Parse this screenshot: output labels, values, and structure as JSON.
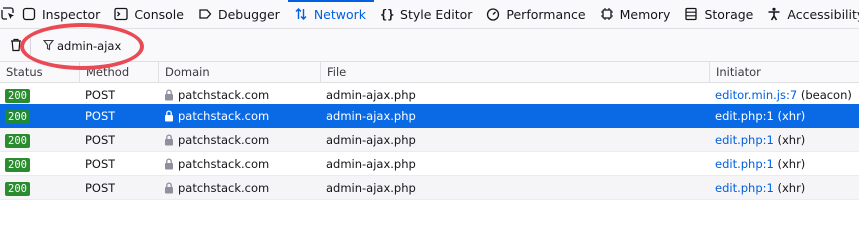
{
  "toolbar": {
    "tabs": [
      {
        "label": "Inspector",
        "icon": "inspector-icon"
      },
      {
        "label": "Console",
        "icon": "console-icon"
      },
      {
        "label": "Debugger",
        "icon": "debugger-icon"
      },
      {
        "label": "Network",
        "icon": "network-icon",
        "active": true
      },
      {
        "label": "Style Editor",
        "icon": "style-editor-icon"
      },
      {
        "label": "Performance",
        "icon": "performance-icon"
      },
      {
        "label": "Memory",
        "icon": "memory-icon"
      },
      {
        "label": "Storage",
        "icon": "storage-icon"
      },
      {
        "label": "Accessibility",
        "icon": "accessibility-icon"
      }
    ],
    "accent_color": "#0061e0"
  },
  "filter": {
    "value": "admin-ajax"
  },
  "table": {
    "columns": [
      "Status",
      "Method",
      "Domain",
      "File",
      "Initiator"
    ],
    "rows": [
      {
        "status": "200",
        "method": "POST",
        "domain": "patchstack.com",
        "file": "admin-ajax.php",
        "initiator_link": "editor.min.js:7",
        "initiator_type": "(beacon)"
      },
      {
        "status": "200",
        "method": "POST",
        "domain": "patchstack.com",
        "file": "admin-ajax.php",
        "initiator_link": "edit.php:1",
        "initiator_type": "(xhr)",
        "selected": true
      },
      {
        "status": "200",
        "method": "POST",
        "domain": "patchstack.com",
        "file": "admin-ajax.php",
        "initiator_link": "edit.php:1",
        "initiator_type": "(xhr)"
      },
      {
        "status": "200",
        "method": "POST",
        "domain": "patchstack.com",
        "file": "admin-ajax.php",
        "initiator_link": "edit.php:1",
        "initiator_type": "(xhr)"
      },
      {
        "status": "200",
        "method": "POST",
        "domain": "patchstack.com",
        "file": "admin-ajax.php",
        "initiator_link": "edit.php:1",
        "initiator_type": "(xhr)"
      }
    ],
    "status_color": "#2a8c2e",
    "selected_color": "#0a6ae5"
  }
}
